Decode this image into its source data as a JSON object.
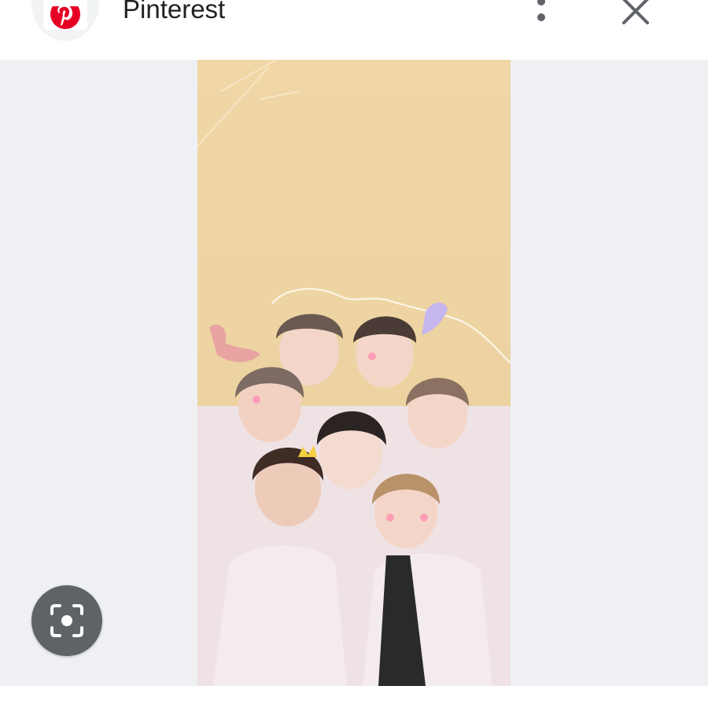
{
  "header": {
    "site_name": "Pinterest",
    "logo_icon": "pinterest-logo-icon",
    "more_icon": "more-vert-icon",
    "close_icon": "close-icon"
  },
  "image": {
    "description_icon": "photo-image"
  },
  "lens": {
    "icon": "lens-scan-icon"
  },
  "colors": {
    "pinterest_red": "#e60023",
    "content_bg": "#eef0f3",
    "lens_bg": "#5f6368",
    "photo_bg": "#ecd3a0"
  }
}
